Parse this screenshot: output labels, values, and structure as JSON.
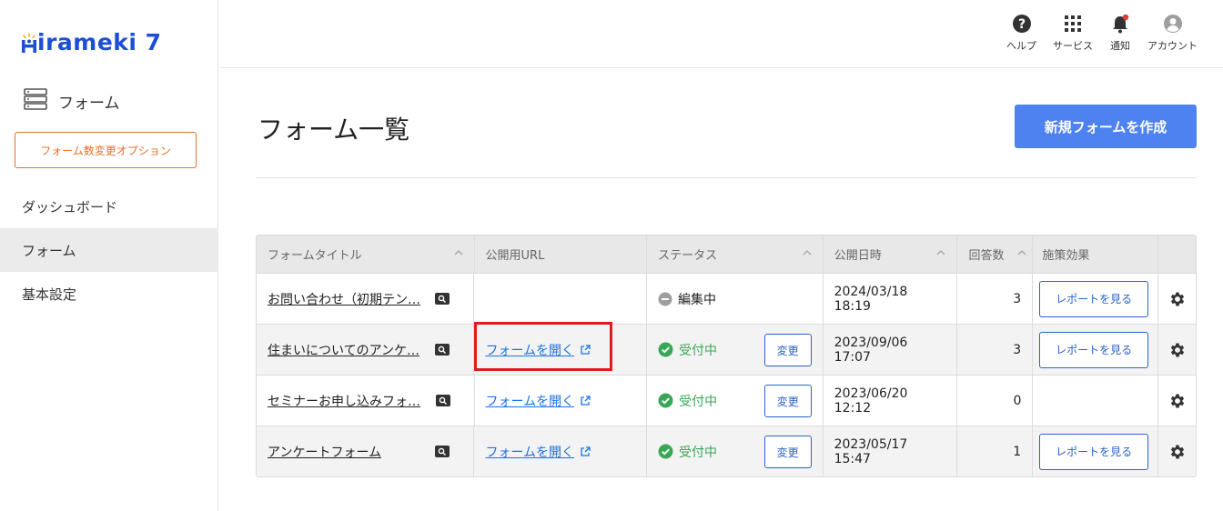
{
  "app": {
    "logo_text": "irameki 7"
  },
  "sidebar": {
    "section_label": "フォーム",
    "option_button": "フォーム数変更オプション",
    "nav": [
      {
        "label": "ダッシュボード",
        "active": false
      },
      {
        "label": "フォーム",
        "active": true
      },
      {
        "label": "基本設定",
        "active": false
      }
    ]
  },
  "topbar": {
    "actions": [
      {
        "label": "ヘルプ",
        "icon": "help-icon"
      },
      {
        "label": "サービス",
        "icon": "grid-icon"
      },
      {
        "label": "通知",
        "icon": "bell-icon"
      },
      {
        "label": "アカウント",
        "icon": "account-icon"
      }
    ]
  },
  "main": {
    "title": "フォーム一覧",
    "new_button": "新規フォームを作成"
  },
  "table": {
    "headers": [
      "フォームタイトル",
      "公開用URL",
      "ステータス",
      "公開日時",
      "回答数",
      "施策効果"
    ],
    "rows": [
      {
        "title": "お問い合わせ（初期テン…",
        "url": "",
        "status": "編集中",
        "status_type": "edit",
        "change": "",
        "date": "2024/03/18 18:19",
        "count": "3",
        "report": "レポートを見る"
      },
      {
        "title": "住まいについてのアンケ…",
        "url": "フォームを開く",
        "status": "受付中",
        "status_type": "open",
        "change": "変更",
        "date": "2023/09/06 17:07",
        "count": "3",
        "report": "レポートを見る"
      },
      {
        "title": "セミナーお申し込みフォ…",
        "url": "フォームを開く",
        "status": "受付中",
        "status_type": "open",
        "change": "変更",
        "date": "2023/06/20 12:12",
        "count": "0",
        "report": ""
      },
      {
        "title": "アンケートフォーム",
        "url": "フォームを開く",
        "status": "受付中",
        "status_type": "open",
        "change": "変更",
        "date": "2023/05/17 15:47",
        "count": "1",
        "report": "レポートを見る"
      }
    ]
  },
  "colors": {
    "brand": "#1d4fd6",
    "primary_button": "#4d82f0",
    "option_orange": "#e8702a",
    "status_open": "#3aa757",
    "highlight": "#e01b1b"
  }
}
